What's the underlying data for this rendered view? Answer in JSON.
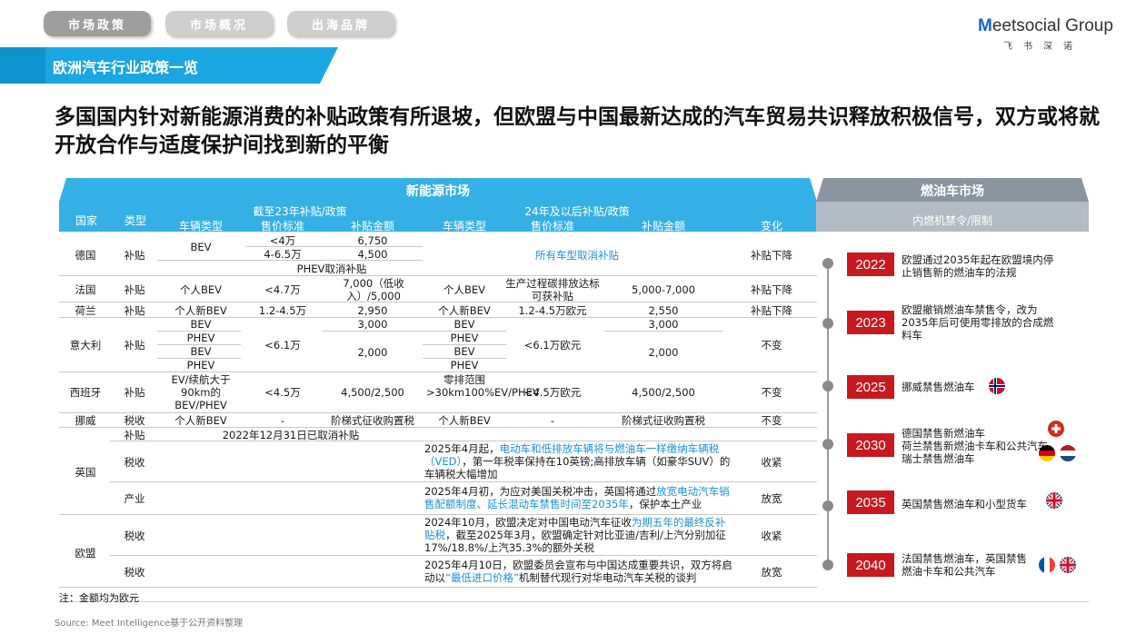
{
  "nav": {
    "tabs": [
      "市场政策",
      "市场概况",
      "出海品牌"
    ],
    "active_index": 0
  },
  "logo": {
    "name_prefix": "M",
    "name_rest": "eetsocial Group",
    "sub": "飞书深诺"
  },
  "section_title": "欧洲汽车行业政策一览",
  "headline": "多国国内针对新能源消费的补贴政策有所退坡，但欧盟与中国最新达成的汽车贸易共识释放积极信号，双方或将就开放合作与适度保护间找到新的平衡",
  "table": {
    "nev_header": "新能源市场",
    "ice_header": "燃油车市场",
    "col_country": "国家",
    "col_type": "类型",
    "group_2023": "截至23年补贴/政策",
    "group_2024": "24年及以后补贴/政策",
    "sub_vehicle": "车辆类型",
    "sub_price": "售价标准",
    "sub_amount": "补贴金额",
    "col_change": "变化",
    "ice_sub": "内燃机禁令/限制",
    "rows": {
      "germany": {
        "country": "德国",
        "type": "补贴",
        "v1": "BEV",
        "p1a": "<4万",
        "p1b": "4-6.5万",
        "a1a": "6,750",
        "a1b": "4,500",
        "phev": "PHEV取消补贴",
        "n24": "所有车型取消补贴",
        "change": "补贴下降"
      },
      "france": {
        "country": "法国",
        "type": "补贴",
        "v1": "个人BEV",
        "p1": "<4.7万",
        "a1": "7,000（低收入）/5,000",
        "v2": "个人BEV",
        "p2": "生产过程碳排放达标可获补贴",
        "a2": "5,000-7,000",
        "change": "补贴下降"
      },
      "netherlands": {
        "country": "荷兰",
        "type": "补贴",
        "v1": "个人新BEV",
        "p1": "1.2-4.5万",
        "a1": "2,950",
        "v2": "个人新BEV",
        "p2": "1.2-4.5万欧元",
        "a2": "2,550",
        "change": "补贴下降"
      },
      "italy": {
        "country": "意大利",
        "type": "补贴",
        "v1a": "BEV",
        "v1b": "PHEV",
        "v1c": "BEV",
        "v1d": "PHEV",
        "p1": "<6.1万",
        "a1a": "3,000",
        "a1b": "2,000",
        "v2a": "BEV",
        "v2b": "PHEV",
        "v2c": "BEV",
        "v2d": "PHEV",
        "p2": "<6.1万欧元",
        "a2a": "3,000",
        "a2b": "2,000",
        "change": "不变"
      },
      "spain": {
        "country": "西班牙",
        "type": "补贴",
        "v1": "EV/续航大于90km的BEV/PHEV",
        "p1": "<4.5万",
        "a1": "4,500/2,500",
        "v2": "零排范围>30km100%EV/PHEV",
        "p2": "<4.5万欧元",
        "a2": "4,500/2,500",
        "change": "不变"
      },
      "norway": {
        "country": "挪威",
        "type": "税收",
        "v1": "个人新BEV",
        "p1": "-",
        "a1": "阶梯式征收购置税",
        "v2": "个人新BEV",
        "p2": "-",
        "a2": "阶梯式征收购置税",
        "change": "不变"
      },
      "uk": {
        "country": "英国",
        "r1_type": "补贴",
        "r1_text": "2022年12月31日已取消补贴",
        "r2_type": "税收",
        "r2_a": "2025年4月起，",
        "r2_hl": "电动车和低排放车辆将与燃油车一样缴纳车辆税（VED）",
        "r2_b": "，第一年税率保持在10英镑;高排放车辆（如豪华SUV）的车辆税大幅增加",
        "r2_change": "收紧",
        "r3_type": "产业",
        "r3_a": "2025年4月初，为应对美国关税冲击，英国将通过",
        "r3_hl": "放宽电动汽车销售配额制度、延长混动车禁售时间至2035年",
        "r3_b": "，保护本土产业",
        "r3_change": "放宽"
      },
      "eu": {
        "country": "欧盟",
        "r1_type": "税收",
        "r1_a": "2024年10月，欧盟决定对中国电动汽车征收",
        "r1_hl": "为期五年的最终反补贴税",
        "r1_b": "，截至2025年3月，欧盟确定针对比亚迪/吉利/上汽分别加征17%/18.8%/上汽35.3%的额外关税",
        "r1_change": "收紧",
        "r2_type": "税收",
        "r2_a": "2025年4月10日，欧盟委员会宣布与中国达成重要共识，双方将启动以",
        "r2_hl": "“最低进口价格”",
        "r2_b": "机制替代现行对华电动汽车关税的谈判",
        "r2_change": "放宽"
      }
    }
  },
  "timeline": [
    {
      "year": "2022",
      "text": "欧盟通过2035年起在欧盟境内停止销售新的燃油车的法规",
      "flags": []
    },
    {
      "year": "2023",
      "text": "欧盟撤销燃油车禁售令，改为2035年后可使用零排放的合成燃料车",
      "flags": []
    },
    {
      "year": "2025",
      "text": "挪威禁售燃油车",
      "flags": [
        "norway-flag"
      ]
    },
    {
      "year": "2030",
      "text_a": "德国禁售新燃油车",
      "text_b": "荷兰禁售新燃油卡车和公共汽车",
      "text_c": "瑞士禁售燃油车",
      "flags": [
        "switzerland-flag",
        "germany-flag",
        "netherlands-flag"
      ]
    },
    {
      "year": "2035",
      "text": "英国禁售燃油车和小型货车",
      "flags": [
        "uk-flag"
      ]
    },
    {
      "year": "2040",
      "text": "法国禁售燃油车，英国禁售燃油卡车和公共汽车",
      "flags": [
        "france-flag",
        "uk-flag"
      ]
    }
  ],
  "note": "注：金额均为欧元",
  "source": "Source: Meet Intelligence基于公开资料整理",
  "colors": {
    "accent_blue": "#35b0e6",
    "banner_blue": "#1aa6e0",
    "ice_gray": "#8a959f",
    "year_red": "#c8191f",
    "highlight_blue": "#1e90d6"
  }
}
